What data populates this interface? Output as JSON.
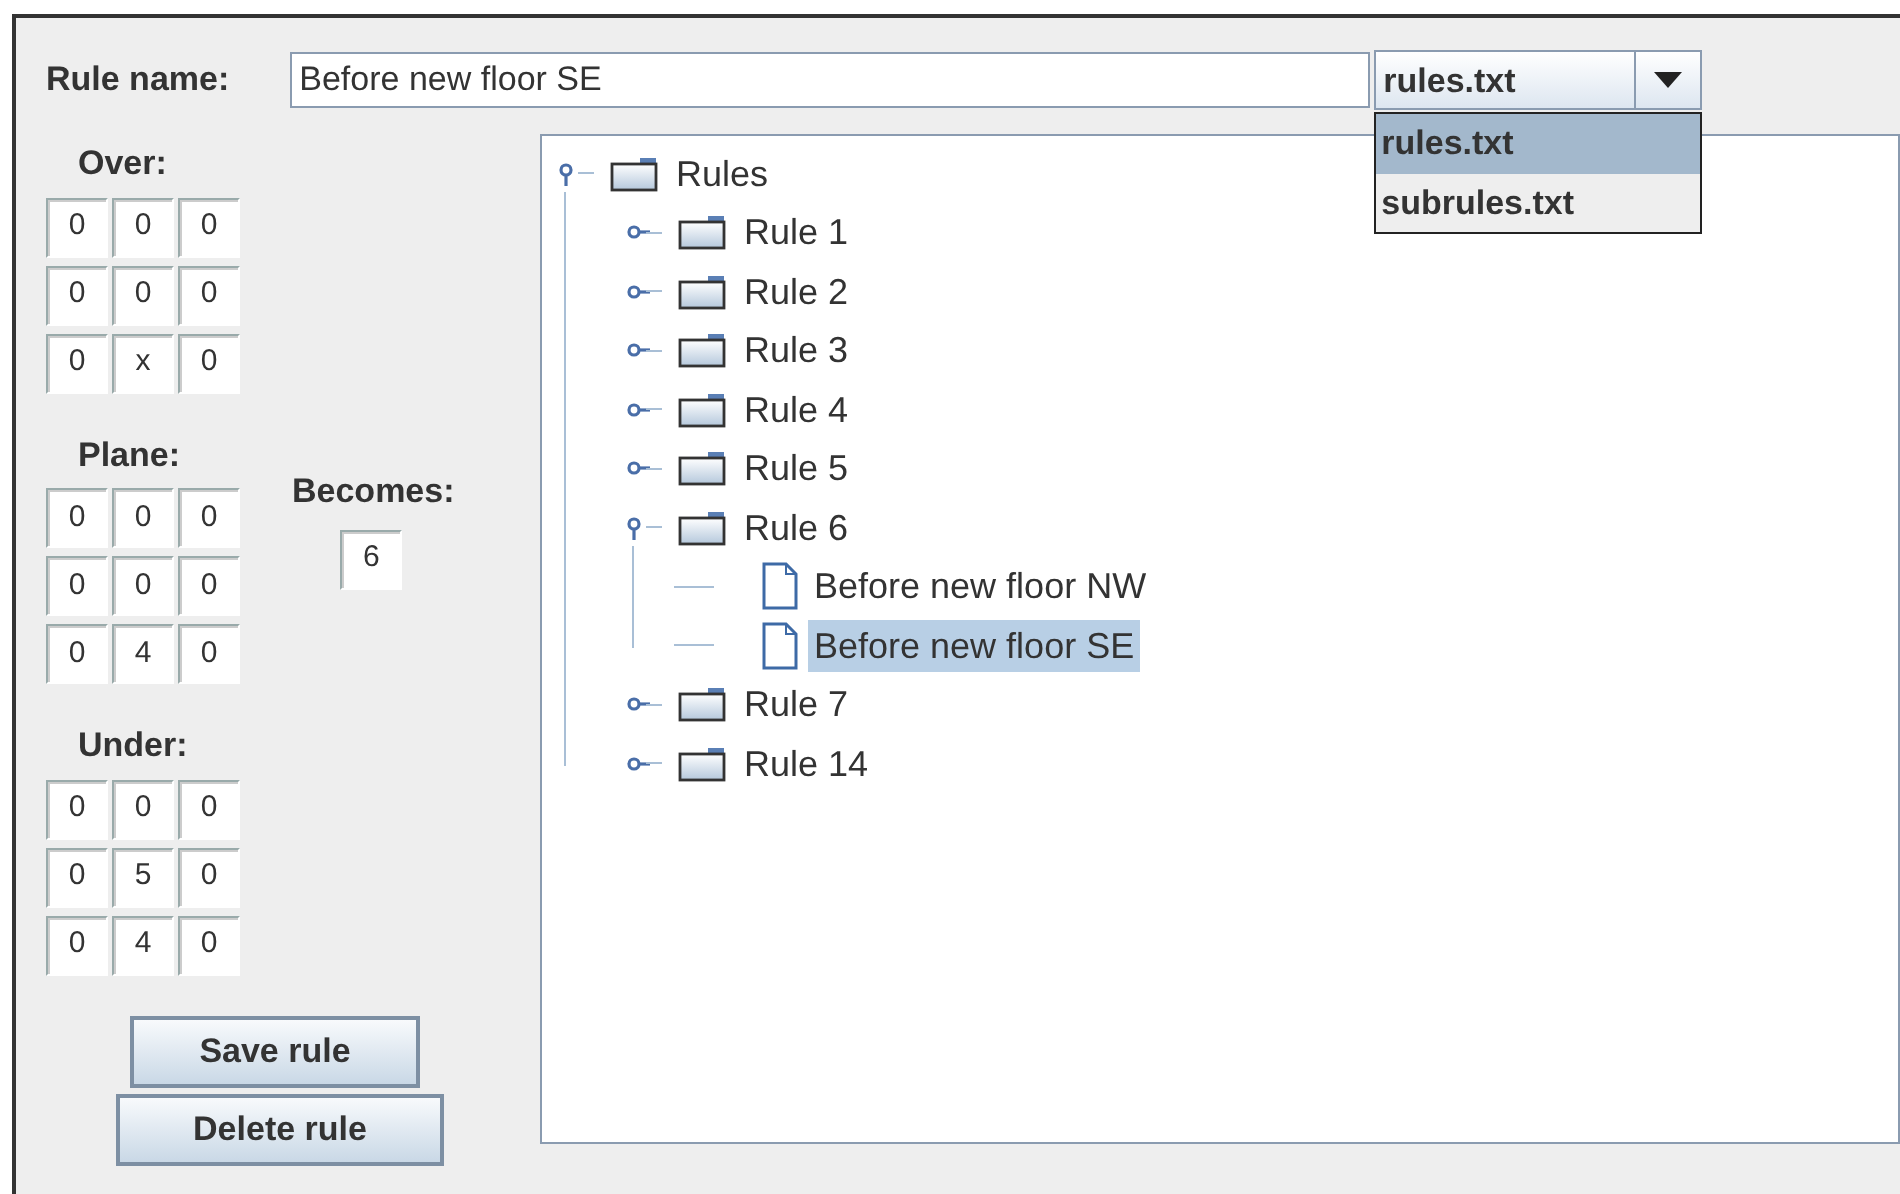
{
  "rule_name": {
    "label": "Rule name:",
    "value": "Before new floor SE"
  },
  "file_combo": {
    "value": "rules.txt",
    "open": true,
    "options": [
      {
        "label": "rules.txt",
        "selected": true
      },
      {
        "label": "subrules.txt",
        "selected": false
      }
    ]
  },
  "grids": [
    {
      "label": "Over:",
      "cells": [
        [
          "0",
          "0",
          "0"
        ],
        [
          "0",
          "0",
          "0"
        ],
        [
          "0",
          "x",
          "0"
        ]
      ]
    },
    {
      "label": "Plane:",
      "cells": [
        [
          "0",
          "0",
          "0"
        ],
        [
          "0",
          "0",
          "0"
        ],
        [
          "0",
          "4",
          "0"
        ]
      ]
    },
    {
      "label": "Under:",
      "cells": [
        [
          "0",
          "0",
          "0"
        ],
        [
          "0",
          "5",
          "0"
        ],
        [
          "0",
          "4",
          "0"
        ]
      ]
    }
  ],
  "becomes": {
    "label": "Becomes:",
    "value": "6"
  },
  "buttons": [
    "Save rule",
    "Delete rule"
  ],
  "tree": {
    "label": "Rules",
    "kind": "folder",
    "expanded": true,
    "selected": false,
    "children": [
      {
        "label": "Rule 1",
        "kind": "folder",
        "expanded": false,
        "selected": false
      },
      {
        "label": "Rule 2",
        "kind": "folder",
        "expanded": false,
        "selected": false
      },
      {
        "label": "Rule 3",
        "kind": "folder",
        "expanded": false,
        "selected": false
      },
      {
        "label": "Rule 4",
        "kind": "folder",
        "expanded": false,
        "selected": false
      },
      {
        "label": "Rule 5",
        "kind": "folder",
        "expanded": false,
        "selected": false
      },
      {
        "label": "Rule 6",
        "kind": "folder",
        "expanded": true,
        "selected": false,
        "children": [
          {
            "label": "Before new floor NW",
            "kind": "file",
            "selected": false
          },
          {
            "label": "Before new floor SE",
            "kind": "file",
            "selected": true
          }
        ]
      },
      {
        "label": "Rule 7",
        "kind": "folder",
        "expanded": false,
        "selected": false
      },
      {
        "label": "Rule 14",
        "kind": "folder",
        "expanded": false,
        "selected": false
      }
    ]
  }
}
